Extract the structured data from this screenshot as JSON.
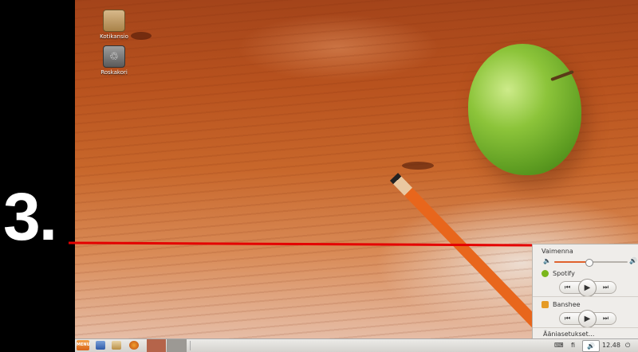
{
  "annotation": {
    "step_number": "3."
  },
  "desktop": {
    "icons": [
      {
        "label": "Kotikansio",
        "icon": "home-folder-icon"
      },
      {
        "label": "Roskakori",
        "icon": "trash-icon"
      }
    ]
  },
  "sound_menu": {
    "mute_label": "Vaimenna",
    "volume_level": 0.47,
    "players": [
      {
        "name": "Spotify",
        "icon": "spotify-icon",
        "color": "#7ab61b"
      },
      {
        "name": "Banshee",
        "icon": "banshee-icon",
        "color": "#e59a25"
      }
    ],
    "controls": {
      "prev": "⏮",
      "play": "▶",
      "next": "⏭"
    },
    "settings_label": "Ääniasetukset..."
  },
  "panel": {
    "menu_label": "MENU",
    "keyboard_glyph": "⌨",
    "keyboard_layout": "fi",
    "volume_glyph": "🔊",
    "clock": "12.48",
    "power_glyph": "⏻"
  },
  "colors": {
    "accent": "#e0622d",
    "callout": "#e40000"
  }
}
